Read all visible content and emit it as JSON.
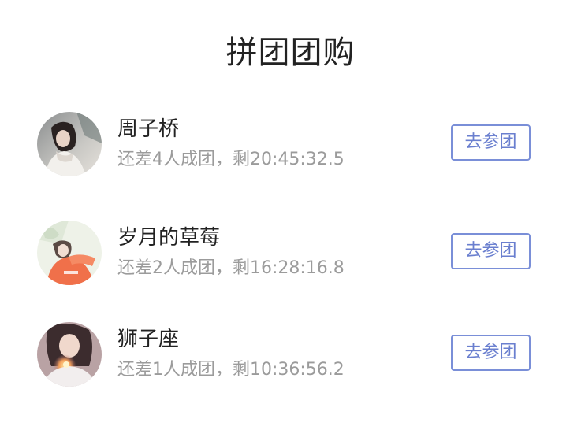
{
  "header": {
    "title": "拼团团购"
  },
  "groups": [
    {
      "name": "周子桥",
      "status": "还差4人成团，剩20:45:32.5",
      "button_label": "去参团"
    },
    {
      "name": "岁月的草莓",
      "status": "还差2人成团，剩16:28:16.8",
      "button_label": "去参团"
    },
    {
      "name": "狮子座",
      "status": "还差1人成团，剩10:36:56.2",
      "button_label": "去参团"
    }
  ],
  "colors": {
    "accent": "#6a7fcf",
    "title_text": "#222222",
    "secondary_text": "#9b9b9b"
  }
}
